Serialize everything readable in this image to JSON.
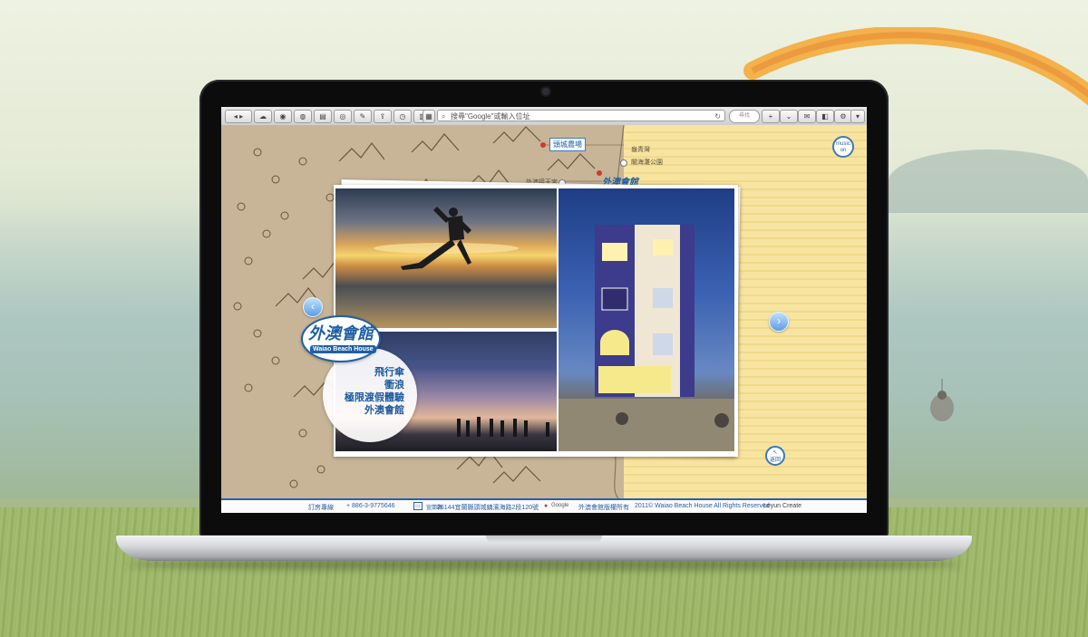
{
  "browser": {
    "address_placeholder": "搜尋\"Google\"或輸入位址",
    "search_placeholder": "尋找"
  },
  "site": {
    "music_label": "music on",
    "back_label": "返回",
    "logo_chinese": "外澳會館",
    "logo_english": "Waiao Beach House",
    "map_labels": {
      "farm": "頭城農場",
      "loc1": "龜青灣",
      "loc2": "閣海灘公園",
      "loc3": "外澳接天宮",
      "waiao": "外澳會館"
    },
    "slogan": [
      "飛行傘",
      "衝浪",
      "極限渡假體驗",
      "外澳會館"
    ],
    "footer": {
      "phone_label": "訂房專線",
      "phone": "+ 886-3-9775646",
      "address_tag": "宣蘭縣",
      "address": "26144宜蘭縣頭城鎮濱海路2段120號",
      "google_label": "Google",
      "copyright_ch": "外澳會館版權所有",
      "copyright_en": "2011© Waiao Beach House All Rights Reserved",
      "credit": "Leyun Create"
    }
  }
}
